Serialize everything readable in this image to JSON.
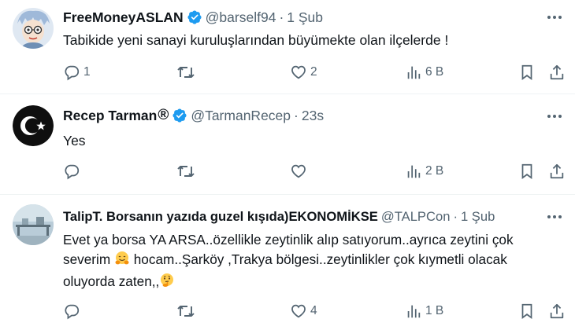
{
  "colors": {
    "text": "#0f1419",
    "secondary": "#536471",
    "verified_blue": "#1d9bf0",
    "divider": "#eff3f4"
  },
  "tweets": [
    {
      "display_name": "FreeMoneyASLAN",
      "handle": "@barself94",
      "separator": "·",
      "time": "1 Şub",
      "verified": true,
      "text": "Tabikide yeni sanayi kuruluşlarından büyümekte olan ilçelerde !",
      "replies": "1",
      "retweets": "",
      "likes": "2",
      "views": "6 B"
    },
    {
      "display_name": "Recep Tarman",
      "name_symbol": "®",
      "handle": "@TarmanRecep",
      "separator": "·",
      "time": "23s",
      "verified": true,
      "text": "Yes",
      "replies": "",
      "retweets": "",
      "likes": "",
      "views": "2 B"
    },
    {
      "display_name": "TalipT. Borsanın yazıda guzel kışıda)EKONOMİKSE",
      "handle": "@TALPCon",
      "separator": "·",
      "time": "1 Şub",
      "verified": false,
      "text_line1": "Evet ya borsa YA ARSA..özellikle zeytinlik alıp satıyorum..ayrıca zeytini çok",
      "text_line2a": "severim ",
      "emoji1": "hugging-face-emoji",
      "text_line2b": " hocam..Şarköy ,Trakya bölgesi..zeytinlikler çok kıymetli olacak",
      "text_line3": "oluyorda zaten,,",
      "emoji2": "thinking-face-emoji",
      "replies": "",
      "retweets": "",
      "likes": "4",
      "views": "1 B"
    }
  ]
}
